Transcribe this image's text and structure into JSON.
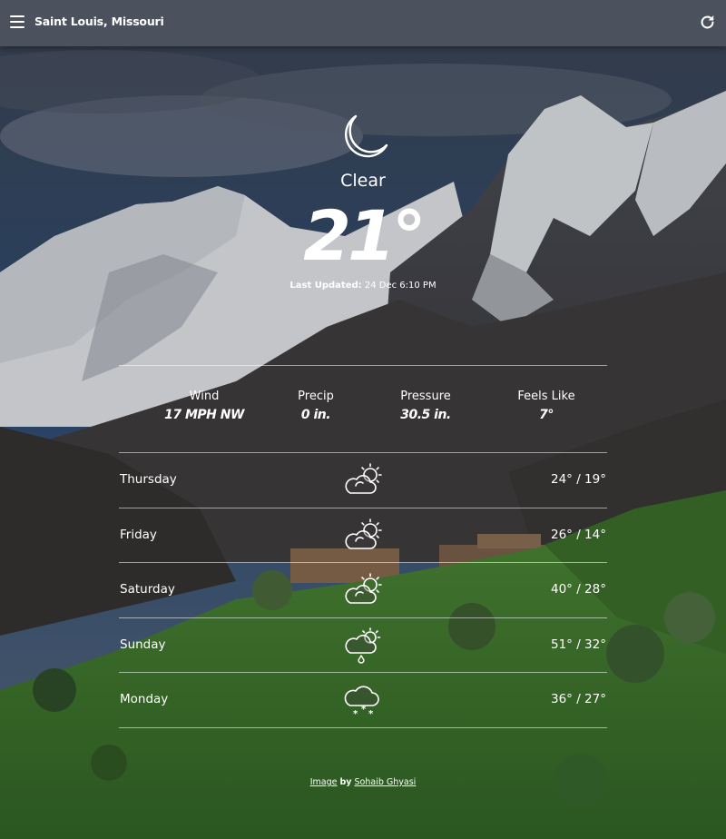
{
  "header": {
    "location": "Saint Louis, Missouri",
    "menu_icon": "hamburger-menu-icon",
    "refresh_icon": "refresh-icon"
  },
  "current": {
    "icon": "moon-icon",
    "condition": "Clear",
    "temperature": "21°",
    "updated_label": "Last Updated:",
    "updated_value": "24 Dec 6:10 PM"
  },
  "stats": [
    {
      "label": "Wind",
      "value": "17 MPH NW"
    },
    {
      "label": "Precip",
      "value": "0 in."
    },
    {
      "label": "Pressure",
      "value": "30.5 in."
    },
    {
      "label": "Feels Like",
      "value": "7°"
    }
  ],
  "forecast": [
    {
      "day": "Thursday",
      "range": "24° / 19°",
      "icon": "partly-cloudy-icon"
    },
    {
      "day": "Friday",
      "range": "26° / 14°",
      "icon": "partly-cloudy-icon"
    },
    {
      "day": "Saturday",
      "range": "40° / 28°",
      "icon": "partly-cloudy-icon"
    },
    {
      "day": "Sunday",
      "range": "51° / 32°",
      "icon": "partly-cloudy-rain-icon"
    },
    {
      "day": "Monday",
      "range": "36° / 27°",
      "icon": "snow-icon"
    }
  ],
  "credit": {
    "prefix": "Image",
    "by": "by",
    "author": "Sohaib Ghyasi"
  },
  "colors": {
    "topbar": "#4e5460",
    "text": "#ffffff",
    "sky": "#2c4a6e",
    "grass": "#3f7a2a"
  }
}
